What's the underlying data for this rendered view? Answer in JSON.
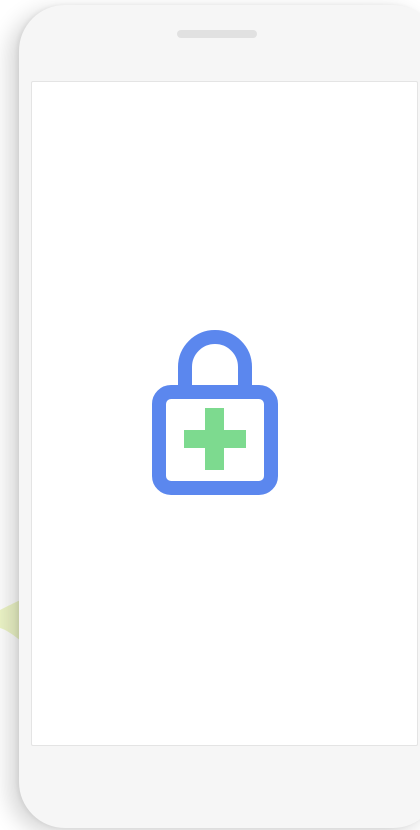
{
  "app": {
    "screen": "lock-add-splash"
  },
  "icons": {
    "lock": "lock-with-plus-icon"
  },
  "colors": {
    "lock_blue": "#5b87ee",
    "plus_green": "#7dda8f",
    "frame": "#f6f6f6",
    "screen": "#ffffff",
    "swoosh": "#eef6c8"
  }
}
